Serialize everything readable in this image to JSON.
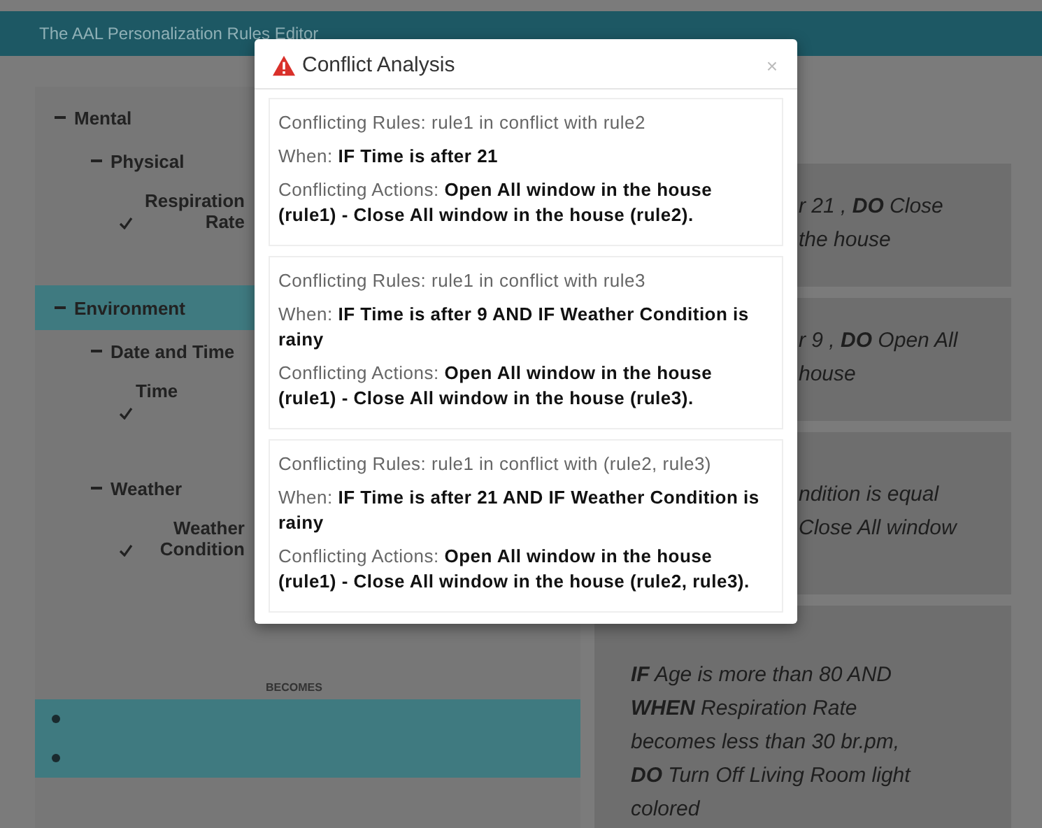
{
  "navbar": {
    "title": "The AAL Personalization Rules Editor"
  },
  "sidebar": {
    "tree": [
      {
        "label": "Mental",
        "expanded": true,
        "selected": false,
        "children": [
          {
            "label": "Physical",
            "expanded": true,
            "children": [
              {
                "label": "Respiration Rate",
                "checked": true
              }
            ]
          }
        ]
      },
      {
        "label": "Environment",
        "expanded": true,
        "selected": true,
        "children": [
          {
            "label": "Date and Time",
            "expanded": true,
            "children": [
              {
                "label": "Time",
                "checked": true
              }
            ]
          },
          {
            "label": "Weather",
            "expanded": true,
            "children": [
              {
                "label": "Weather Condition",
                "checked": true
              }
            ]
          }
        ]
      }
    ],
    "connector_label": "BECOMES"
  },
  "rule_cards": [
    {
      "lines": [
        "r 21 , **DO** Close",
        "the house"
      ]
    },
    {
      "lines": [
        "r 9 , **DO** Open All",
        "house"
      ]
    },
    {
      "lines": [
        "ndition is equal",
        "Close All window"
      ]
    },
    {
      "lines": [
        "**IF** Age is more than 80 AND",
        "**WHEN** Respiration Rate",
        "becomes less than 30 br.pm,",
        "**DO** Turn Off Living Room light",
        "colored"
      ]
    }
  ],
  "modal": {
    "title": "Conflict Analysis",
    "close": "×",
    "conflicts": [
      {
        "rules_label": "Conflicting Rules:",
        "rules": "rule1 in conflict with rule2",
        "when_label": "When:",
        "when": "IF Time is after 21",
        "actions_label": "Conflicting Actions:",
        "actions": "Open All window in the house (rule1) - Close All window in the house (rule2)."
      },
      {
        "rules_label": "Conflicting Rules:",
        "rules": "rule1 in conflict with rule3",
        "when_label": "When:",
        "when": "IF Time is after 9 AND IF Weather Condition is rainy",
        "actions_label": "Conflicting Actions:",
        "actions": "Open All window in the house (rule1) - Close All window in the house (rule3)."
      },
      {
        "rules_label": "Conflicting Rules:",
        "rules": "rule1 in conflict with (rule2, rule3)",
        "when_label": "When:",
        "when": "IF Time is after 21 AND IF Weather Condition is rainy",
        "actions_label": "Conflicting Actions:",
        "actions": "Open All window in the house (rule1) - Close All window in the house (rule2, rule3)."
      }
    ]
  }
}
